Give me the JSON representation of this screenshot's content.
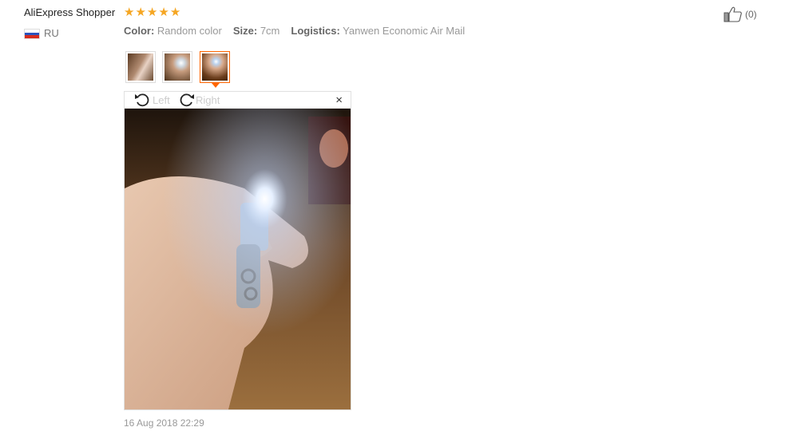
{
  "review": {
    "reviewer_name": "AliExpress Shopper",
    "rating": 5,
    "country_code": "RU",
    "specs": [
      {
        "key": "Color:",
        "value": "Random color"
      },
      {
        "key": "Size:",
        "value": "7cm"
      },
      {
        "key": "Logistics:",
        "value": "Yanwen Economic Air Mail"
      }
    ],
    "helpful_count": "(0)",
    "date": "16 Aug 2018 22:29"
  },
  "gallery": {
    "thumbnail_count": 3,
    "active_index": 3,
    "viewer": {
      "rotate_left_label": "Left",
      "rotate_right_label": "Right",
      "close_glyph": "×"
    }
  },
  "icons": {
    "star": "star-icon",
    "like": "thumbs-up-icon",
    "rotate_left": "rotate-left-icon",
    "rotate_right": "rotate-right-icon",
    "close": "close-icon"
  },
  "colors": {
    "star": "#f5a623",
    "active_thumb_border": "#ff6600",
    "text_muted": "#999999"
  }
}
